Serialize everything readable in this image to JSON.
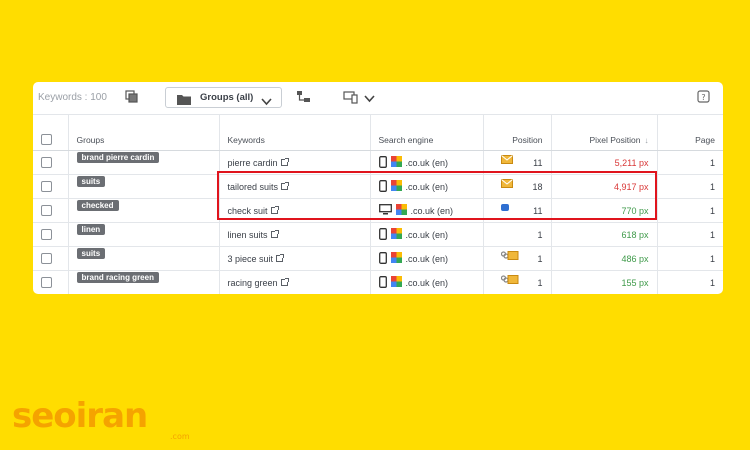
{
  "toolbar": {
    "keywords_label": "Keywords : 100",
    "groups_dropdown": "Groups (all)"
  },
  "columns": [
    "Groups",
    "Keywords",
    "Search engine",
    "Position",
    "Pixel Position",
    "Page"
  ],
  "rows": [
    {
      "group": "brand pierre cardin",
      "keyword": "pierre cardin",
      "device": "mobile",
      "engine": ".co.uk (en)",
      "position_icon": "mail-icon",
      "position": "11",
      "pixel_position": "5,211 px",
      "pixel_status": "red",
      "page": "1"
    },
    {
      "group": "suits",
      "keyword": "tailored suits",
      "device": "mobile",
      "engine": ".co.uk (en)",
      "position_icon": "mail-icon",
      "position": "18",
      "pixel_position": "4,917 px",
      "pixel_status": "red",
      "page": "1"
    },
    {
      "group": "checked",
      "keyword": "check suit",
      "device": "desktop",
      "engine": ".co.uk (en)",
      "position_icon": "badge-icon",
      "position": "11",
      "pixel_position": "770 px",
      "pixel_status": "green",
      "page": "1"
    },
    {
      "group": "linen",
      "keyword": "linen suits",
      "device": "mobile",
      "engine": ".co.uk (en)",
      "position_icon": "",
      "position": "1",
      "pixel_position": "618 px",
      "pixel_status": "green",
      "page": "1"
    },
    {
      "group": "suits",
      "keyword": "3 piece suit",
      "device": "mobile",
      "engine": ".co.uk (en)",
      "position_icon": "link-mail-icon",
      "position": "1",
      "pixel_position": "486 px",
      "pixel_status": "green",
      "page": "1"
    },
    {
      "group": "brand racing green",
      "keyword": "racing green",
      "device": "mobile",
      "engine": ".co.uk (en)",
      "position_icon": "link-mail-icon",
      "position": "1",
      "pixel_position": "155 px",
      "pixel_status": "green",
      "page": "1"
    }
  ],
  "colors": {
    "background": "#ffdd00",
    "red": "#d93838",
    "green": "#3f9a4a",
    "highlight": "#e0141d",
    "logo": "#f5a300"
  },
  "logo": {
    "text": "seoiran",
    "suffix": ".com"
  }
}
